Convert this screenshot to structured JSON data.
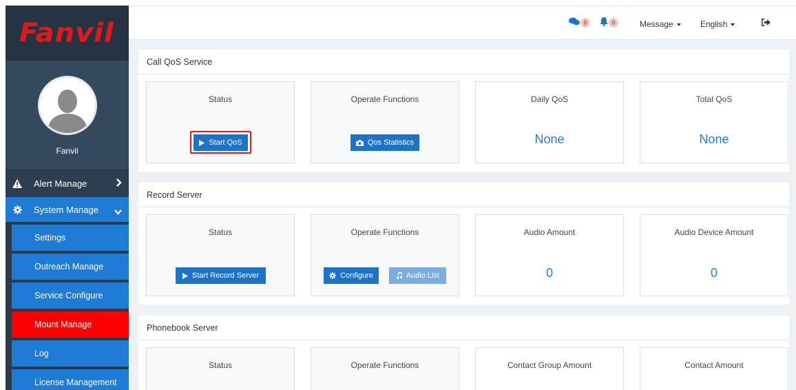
{
  "brand": {
    "logo_text": "Fanvil",
    "logo_color": "#e5171b"
  },
  "profile": {
    "name": "Fanvil"
  },
  "sidebar": {
    "alert": {
      "label": "Alert Manage",
      "icon": "warning-icon"
    },
    "system": {
      "label": "System Manage",
      "icon": "gear-icon"
    },
    "items": [
      {
        "label": "Settings"
      },
      {
        "label": "Outreach Manage"
      },
      {
        "label": "Service Configure"
      },
      {
        "label": "Mount Manage",
        "active": true
      },
      {
        "label": "Log"
      },
      {
        "label": "License Management"
      }
    ]
  },
  "topbar": {
    "chat_count": "0",
    "bell_count": "0",
    "message_label": "Message",
    "language_label": "English"
  },
  "call_qos": {
    "title": "Call QoS Service",
    "status_title": "Status",
    "start_button": "Start QoS",
    "operate_title": "Operate Functions",
    "stats_button": "Qos Statistics",
    "daily_title": "Daily QoS",
    "daily_value": "None",
    "total_title": "Total QoS",
    "total_value": "None"
  },
  "record": {
    "title": "Record Server",
    "status_title": "Status",
    "start_button": "Start Record Server",
    "operate_title": "Operate Functions",
    "configure_button": "Configure",
    "audio_list_button": "Audio List",
    "audio_amount_title": "Audio Amount",
    "audio_amount_value": "0",
    "device_amount_title": "Audio Device Amount",
    "device_amount_value": "0"
  },
  "phonebook": {
    "title": "Phonebook Server",
    "status_title": "Status",
    "operate_title": "Operate Functions",
    "group_title": "Contact Group Amount",
    "contact_title": "Contact Amount"
  },
  "colors": {
    "accent": "#1e7bd6",
    "active": "#ff0000",
    "sidebar_bg": "#2b3a49"
  }
}
